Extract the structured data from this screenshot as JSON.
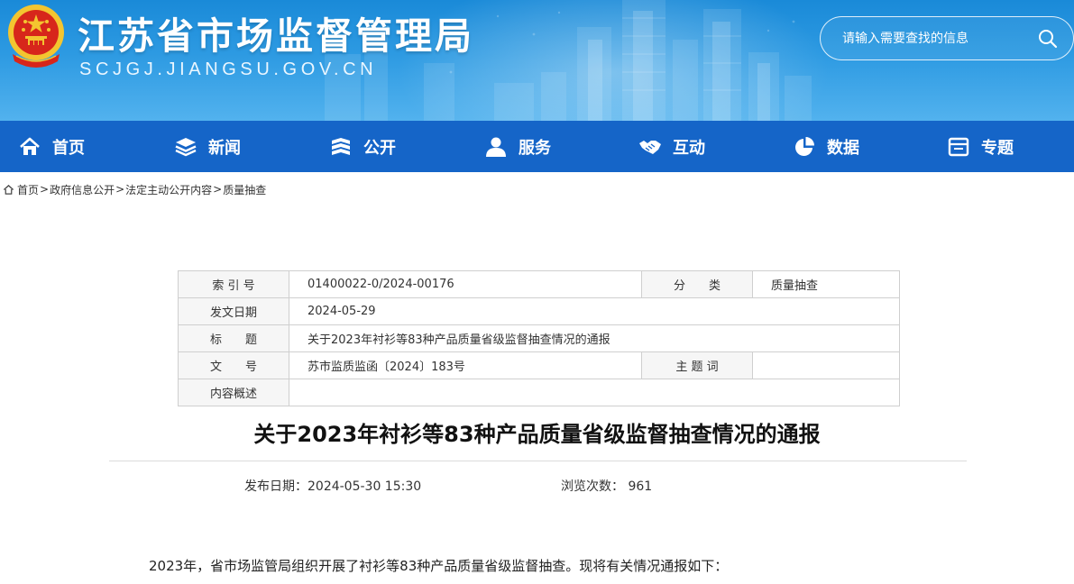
{
  "header": {
    "site_title": "江苏省市场监督管理局",
    "site_domain": "SCJGJ.JIANGSU.GOV.CN",
    "emblem": "national-emblem",
    "search": {
      "placeholder": "请输入需要查找的信息",
      "icon": "search-icon"
    }
  },
  "nav": {
    "items": [
      {
        "label": "首页",
        "icon": "home-icon"
      },
      {
        "label": "新闻",
        "icon": "layers-icon"
      },
      {
        "label": "公开",
        "icon": "open-book-icon"
      },
      {
        "label": "服务",
        "icon": "person-icon"
      },
      {
        "label": "互动",
        "icon": "handshake-icon"
      },
      {
        "label": "数据",
        "icon": "pie-chart-icon"
      },
      {
        "label": "专题",
        "icon": "topic-icon"
      }
    ]
  },
  "breadcrumb": {
    "icon": "home-icon",
    "items": [
      "首页",
      "政府信息公开",
      "法定主动公开内容",
      "质量抽查"
    ],
    "separator": ">"
  },
  "info_table": {
    "index_label": "索 引 号",
    "index_value": "01400022-0/2024-00176",
    "category_label": "分　　类",
    "category_value": "质量抽查",
    "date_label": "发文日期",
    "date_value": "2024-05-29",
    "title_label": "标　　题",
    "title_value": "关于2023年衬衫等83种产品质量省级监督抽查情况的通报",
    "docno_label": "文　　号",
    "docno_value": "苏市监质监函〔2024〕183号",
    "subject_label": "主 题 词",
    "subject_value": "",
    "summary_label": "内容概述",
    "summary_value": ""
  },
  "article": {
    "title": "关于2023年衬衫等83种产品质量省级监督抽查情况的通报",
    "publish_label": "发布日期：",
    "publish_value": "2024-05-30 15:30",
    "views_label": "浏览次数：",
    "views_value": "961",
    "paragraph": "2023年，省市场监管局组织开展了衬衫等83种产品质量省级监督抽查。现将有关情况通报如下："
  },
  "colors": {
    "banner": "#2d9ae2",
    "nav": "#1565c8",
    "emblem_red": "#d7261b",
    "emblem_gold": "#f3c530"
  }
}
